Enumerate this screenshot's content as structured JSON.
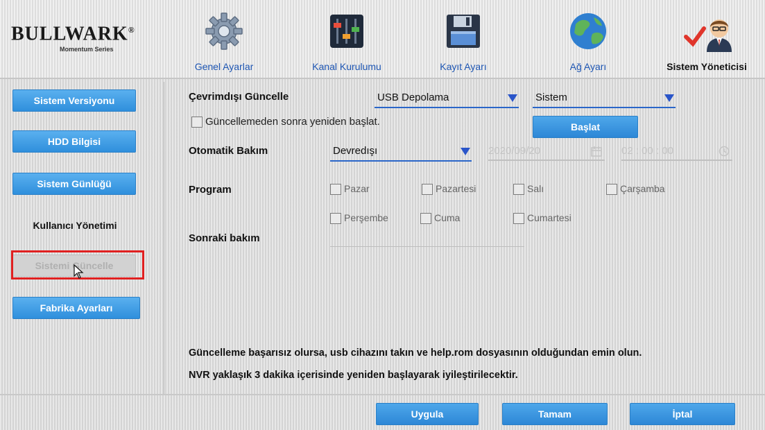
{
  "brand": {
    "name": "BULLWARK",
    "registered": "®",
    "series": "Momentum Series"
  },
  "tabs": [
    {
      "label": "Genel Ayarlar",
      "icon": "gear-icon"
    },
    {
      "label": "Kanal Kurulumu",
      "icon": "mixer-sliders-icon"
    },
    {
      "label": "Kayıt Ayarı",
      "icon": "floppy-disk-icon"
    },
    {
      "label": "Ağ Ayarı",
      "icon": "globe-icon"
    },
    {
      "label": "Sistem Yöneticisi",
      "icon": "admin-user-icon",
      "active": true
    }
  ],
  "sidebar": {
    "items": [
      {
        "label": "Sistem Versiyonu",
        "state": "normal"
      },
      {
        "label": "HDD Bilgisi",
        "state": "normal"
      },
      {
        "label": "Sistem Günlüğü",
        "state": "normal"
      },
      {
        "label": "Kullanıcı Yönetimi",
        "state": "plain"
      },
      {
        "label": "Sistemi Güncelle",
        "state": "selected"
      },
      {
        "label": "Fabrika Ayarları",
        "state": "normal"
      }
    ]
  },
  "offline_update": {
    "label": "Çevrimdışı Güncelle",
    "source_value": "USB Depolama",
    "target_value": "Sistem",
    "restart_checkbox_label": "Güncellemeden sonra yeniden başlat.",
    "restart_checked": false,
    "start_button": "Başlat"
  },
  "auto_maintenance": {
    "label": "Otomatik Bakım",
    "value": "Devredışı",
    "date_value": "2020/09/20",
    "time_value": "02 : 00 : 00"
  },
  "program": {
    "label": "Program",
    "days": [
      {
        "label": "Pazar",
        "checked": false
      },
      {
        "label": "Pazartesi",
        "checked": false
      },
      {
        "label": "Salı",
        "checked": false
      },
      {
        "label": "Çarşamba",
        "checked": false
      },
      {
        "label": "Perşembe",
        "checked": false
      },
      {
        "label": "Cuma",
        "checked": false
      },
      {
        "label": "Cumartesi",
        "checked": false
      }
    ]
  },
  "next_maintenance": {
    "label": "Sonraki bakım",
    "value": ""
  },
  "notes": {
    "line1": "Güncelleme başarısız olursa, usb cihazını takın ve help.rom dosyasının olduğundan emin olun.",
    "line2": "NVR yaklaşık 3 dakika içerisinde yeniden başlayarak iyileştirilecektir."
  },
  "footer": {
    "apply": "Uygula",
    "ok": "Tamam",
    "cancel": "İptal"
  },
  "colors": {
    "accent": "#2f8fdc",
    "tab_label": "#1e56b3",
    "highlight": "#e02020"
  }
}
